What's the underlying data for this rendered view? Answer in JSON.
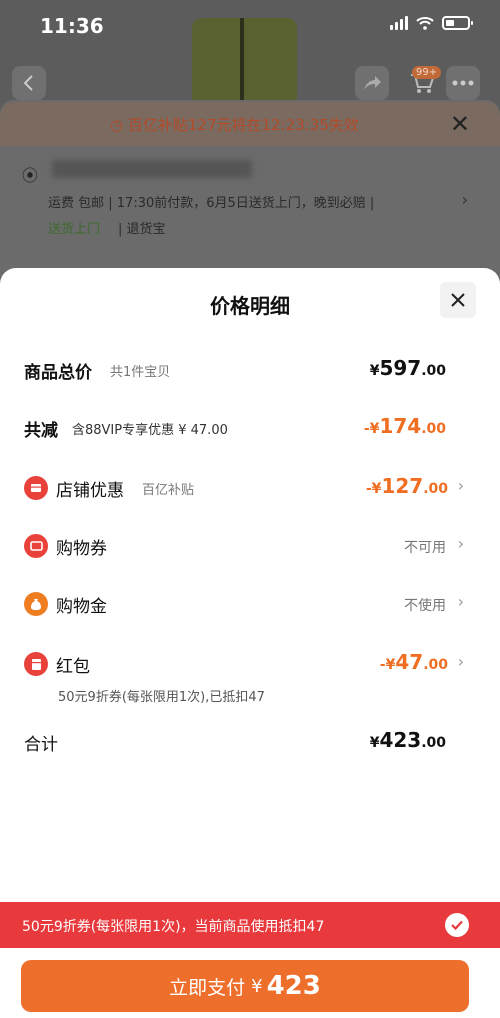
{
  "status_bar": {
    "time": "11:36"
  },
  "background": {
    "cart_badge": "99+",
    "countdown_text": "百亿补贴127元将在12:23:35失效",
    "shipping_text": "运费  包邮 | 17:30前付款，6月5日送货上门，晚到必赔 |",
    "tag_delivery": "送货上门",
    "tag_return": "| 退货宝"
  },
  "sheet": {
    "title": "价格明细",
    "rows": {
      "total": {
        "label": "商品总价",
        "sub": "共1件宝贝",
        "currency": "¥",
        "int": "597",
        "dec": ".00"
      },
      "reduce": {
        "label": "共减",
        "sub": "含88VIP专享优惠 ¥ 47.00",
        "currency": "-¥",
        "int": "174",
        "dec": ".00"
      },
      "shop": {
        "label": "店铺优惠",
        "sub": "百亿补贴",
        "currency": "-¥",
        "int": "127",
        "dec": ".00"
      },
      "voucher": {
        "label": "购物券",
        "status": "不可用"
      },
      "gold": {
        "label": "购物金",
        "status": "不使用"
      },
      "hongbao": {
        "label": "红包",
        "currency": "-¥",
        "int": "47",
        "dec": ".00",
        "note": "50元9折券(每张限用1次),已抵扣47"
      },
      "sum": {
        "label": "合计",
        "currency": "¥",
        "int": "423",
        "dec": ".00"
      }
    }
  },
  "banner": {
    "text": "50元9折券(每张限用1次)，当前商品使用抵扣47"
  },
  "pay_button": {
    "label": "立即支付",
    "currency": "¥",
    "amount": "423"
  },
  "colors": {
    "accent_orange": "#f06e22",
    "banner_red": "#e8393d",
    "pay_orange": "#ee6f2c"
  },
  "icons": [
    "back-icon",
    "share-icon",
    "cart-icon",
    "more-icon",
    "clock-icon",
    "close-icon",
    "location-icon",
    "store-icon",
    "ticket-icon",
    "coin-bag-icon",
    "red-packet-icon",
    "chevron-right-icon",
    "check-icon"
  ]
}
